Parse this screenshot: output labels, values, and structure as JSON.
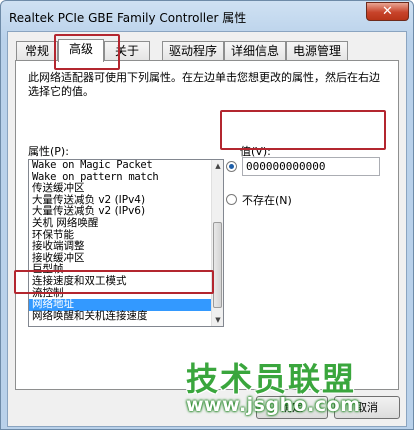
{
  "window": {
    "title": "Realtek PCIe GBE Family Controller 属性",
    "close_glyph": "✕"
  },
  "tabs": [
    {
      "label": "常规"
    },
    {
      "label": "高级"
    },
    {
      "label": "关于"
    },
    {
      "label": "驱动程序"
    },
    {
      "label": "详细信息"
    },
    {
      "label": "电源管理"
    }
  ],
  "active_tab": "高级",
  "description": "此网络适配器可使用下列属性。在左边单击您想更改的属性，然后在右边选择它的值。",
  "properties": {
    "label": "属性(P):",
    "items": [
      "Wake on Magic Packet",
      "Wake on pattern match",
      "传送缓冲区",
      "大量传送减负 v2 (IPv4)",
      "大量传送减负 v2 (IPv6)",
      "关机 网络唤醒",
      "环保节能",
      "接收端调整",
      "接收缓冲区",
      "巨型帧",
      "连接速度和双工模式",
      "流控制",
      "网络地址",
      "网络唤醒和关机连接速度"
    ],
    "selected": "网络地址"
  },
  "value": {
    "label": "值(V):",
    "current": "000000000000",
    "none_label": "不存在(N)"
  },
  "buttons": {
    "ok": "确定",
    "cancel": "取消"
  },
  "watermark": {
    "main": "技术员联盟",
    "url": "www.jsgho.com"
  },
  "colors": {
    "highlight_box": "#b3262f",
    "selection": "#3399ff",
    "watermark_green": "#3aa63d"
  }
}
